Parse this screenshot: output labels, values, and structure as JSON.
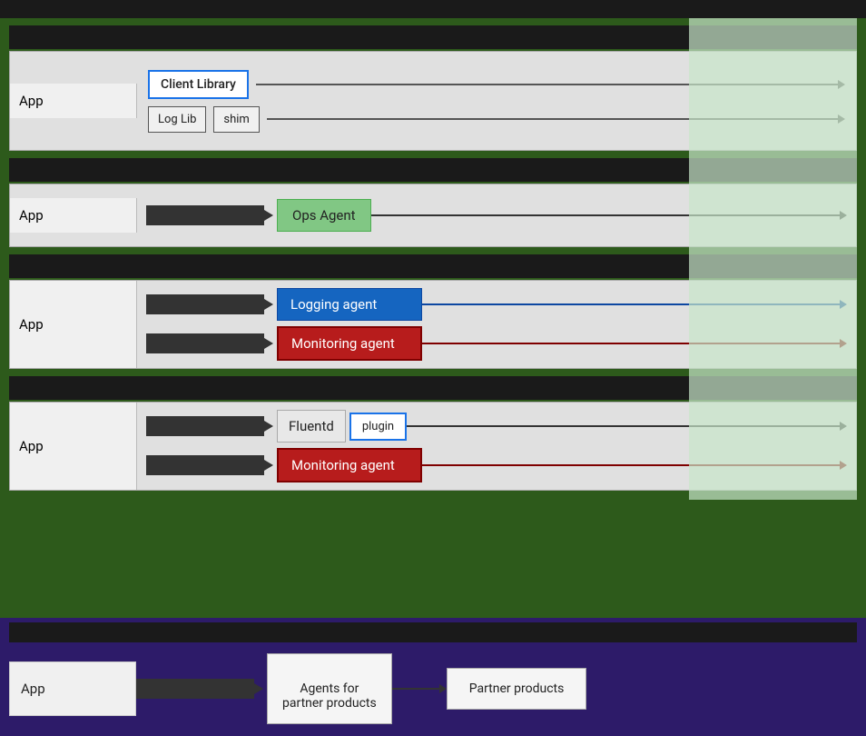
{
  "topBar": {},
  "rows": [
    {
      "id": "client-lib-row",
      "header": "",
      "appLabel": "App",
      "components": {
        "clientLibrary": "Client Library",
        "logLib": "Log Lib",
        "shim": "shim"
      }
    },
    {
      "id": "ops-agent-row",
      "header": "",
      "appLabel": "App",
      "agent": "Ops Agent"
    },
    {
      "id": "separate-agents-row",
      "header": "",
      "appLabel": "App",
      "agents": [
        "Logging agent",
        "Monitoring agent"
      ]
    },
    {
      "id": "fluentd-row",
      "header": "",
      "appLabel": "App",
      "agent1": "Fluentd",
      "plugin": "plugin",
      "agent2": "Monitoring agent"
    }
  ],
  "partnerSection": {
    "appLabel": "App",
    "agentsBox": "Agents for\npartner products",
    "partnerBox": "Partner products"
  }
}
